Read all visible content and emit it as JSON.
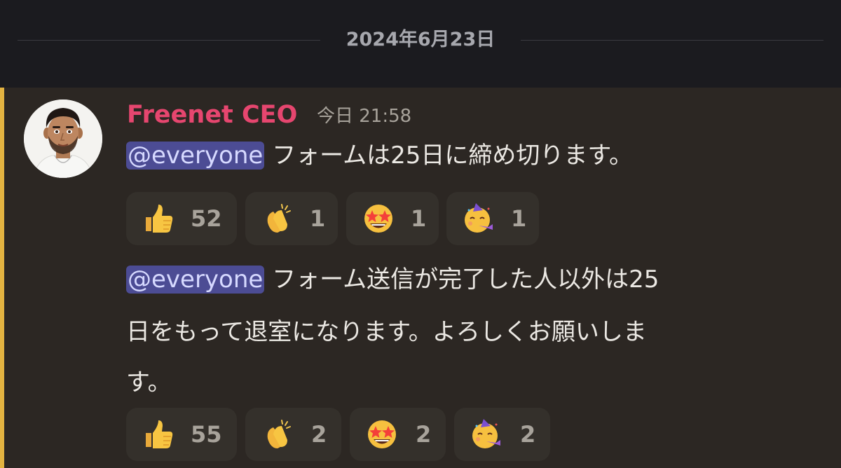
{
  "date_divider": "2024年6月23日",
  "author": {
    "name": "Freenet CEO",
    "timestamp": "今日 21:58"
  },
  "colors": {
    "author": "#e6466f",
    "mention_bg": "#4c4c94",
    "highlight_bar": "#e3b341",
    "message_bg": "#2c2723"
  },
  "messages": [
    {
      "mention": "@everyone",
      "lines": [
        " フォームは25日に締め切ります。"
      ],
      "reactions": [
        {
          "emoji": "thumbs-up",
          "count": "52"
        },
        {
          "emoji": "clapping-hands",
          "count": "1"
        },
        {
          "emoji": "star-struck",
          "count": "1"
        },
        {
          "emoji": "partying-face",
          "count": "1"
        }
      ]
    },
    {
      "mention": "@everyone",
      "lines": [
        " フォーム送信が完了した人以外は25",
        "日をもって退室になります。よろしくお願いしま",
        "す。"
      ],
      "reactions": [
        {
          "emoji": "thumbs-up",
          "count": "55"
        },
        {
          "emoji": "clapping-hands",
          "count": "2"
        },
        {
          "emoji": "star-struck",
          "count": "2"
        },
        {
          "emoji": "partying-face",
          "count": "2"
        }
      ]
    }
  ]
}
